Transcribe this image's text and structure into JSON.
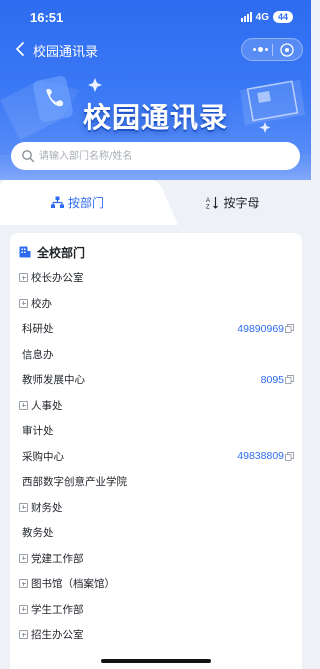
{
  "status_bar": {
    "time": "16:51",
    "network": "4G",
    "battery": "44"
  },
  "nav": {
    "title": "校园通讯录"
  },
  "hero": {
    "title": "校园通讯录"
  },
  "search": {
    "placeholder": "请输入部门名称/姓名",
    "value": ""
  },
  "tabs": [
    {
      "label": "按部门",
      "icon": "org-chart-icon",
      "active": true
    },
    {
      "label": "按字母",
      "icon": "sort-alpha-icon",
      "active": false
    }
  ],
  "card": {
    "title": "全校部门",
    "icon": "building-icon"
  },
  "departments": [
    {
      "name": "校长办公室",
      "expandable": true,
      "phone": ""
    },
    {
      "name": "校办",
      "expandable": true,
      "phone": ""
    },
    {
      "name": "科研处",
      "expandable": false,
      "phone": "49890969"
    },
    {
      "name": "信息办",
      "expandable": false,
      "phone": ""
    },
    {
      "name": "教师发展中心",
      "expandable": false,
      "phone": "8095"
    },
    {
      "name": "人事处",
      "expandable": true,
      "phone": ""
    },
    {
      "name": "审计处",
      "expandable": false,
      "phone": ""
    },
    {
      "name": "采购中心",
      "expandable": false,
      "phone": "49838809"
    },
    {
      "name": "西部数字创意产业学院",
      "expandable": false,
      "phone": ""
    },
    {
      "name": "财务处",
      "expandable": true,
      "phone": ""
    },
    {
      "name": "教务处",
      "expandable": false,
      "phone": ""
    },
    {
      "name": "党建工作部",
      "expandable": true,
      "phone": ""
    },
    {
      "name": "图书馆（档案馆）",
      "expandable": true,
      "phone": ""
    },
    {
      "name": "学生工作部",
      "expandable": true,
      "phone": ""
    },
    {
      "name": "招生办公室",
      "expandable": true,
      "phone": ""
    }
  ],
  "colors": {
    "accent": "#2d6cf0",
    "hero_top": "#2d6cf0",
    "page_bg": "#eef1f6"
  }
}
